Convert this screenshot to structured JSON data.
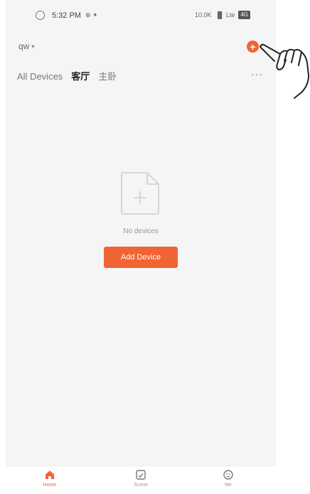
{
  "status_bar": {
    "time": "5:32 PM",
    "left_icons": "⊕ ✦",
    "right_text": "10.0K",
    "signal": "▐▌ Lte",
    "battery": "4G"
  },
  "header": {
    "home_name": "qw",
    "caret": "▾",
    "add_icon": "plus-circle-icon",
    "add_label": "+"
  },
  "tabs": [
    {
      "label": "All Devices",
      "active": false
    },
    {
      "label": "客厅",
      "active": true
    },
    {
      "label": "主卧",
      "active": false
    }
  ],
  "more_label": "···",
  "empty_state": {
    "icon": "add-file-icon",
    "message": "No devices",
    "button_label": "Add Device"
  },
  "bottom_nav": [
    {
      "label": "Home",
      "icon": "home-icon",
      "active": true
    },
    {
      "label": "Scene",
      "icon": "scene-icon",
      "active": false
    },
    {
      "label": "Me",
      "icon": "me-icon",
      "active": false
    }
  ],
  "colors": {
    "accent": "#f06433",
    "background": "#f5f5f5",
    "muted_text": "#999999"
  }
}
